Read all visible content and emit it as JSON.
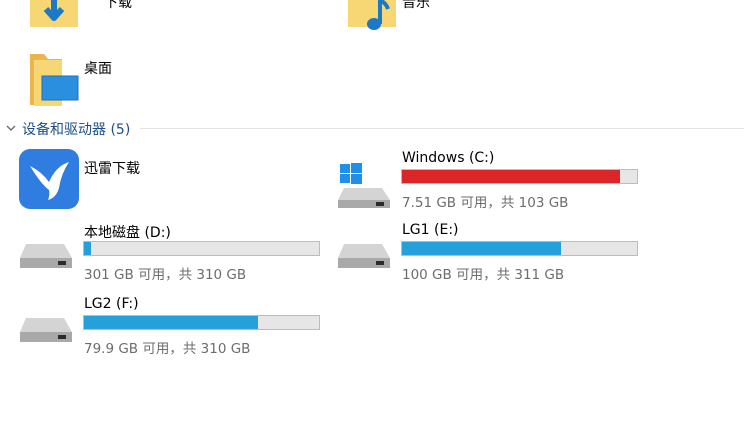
{
  "folders": [
    {
      "label": "下载",
      "icon": "downloads-folder-icon"
    },
    {
      "label": "音乐",
      "icon": "music-folder-icon"
    },
    {
      "label": "桌面",
      "icon": "desktop-folder-icon"
    }
  ],
  "section": {
    "title": "设备和驱动器 (5)",
    "chevron": "chevron-down-icon"
  },
  "app": {
    "label": "迅雷下载",
    "icon": "thunder-bird-icon",
    "accent": "#2f7de1"
  },
  "drives": [
    {
      "name": "Windows (C:)",
      "space": "7.51 GB 可用，共 103 GB",
      "used_fraction": 0.927,
      "bar_color": "#da2626",
      "icon": "windows-drive-icon"
    },
    {
      "name": "本地磁盘 (D:)",
      "space": "301 GB 可用，共 310 GB",
      "used_fraction": 0.029,
      "bar_color": "#26a0da",
      "icon": "hard-drive-icon"
    },
    {
      "name": "LG1 (E:)",
      "space": "100 GB 可用，共 311 GB",
      "used_fraction": 0.678,
      "bar_color": "#26a0da",
      "icon": "hard-drive-icon"
    },
    {
      "name": "LG2 (F:)",
      "space": "79.9 GB 可用，共 310 GB",
      "used_fraction": 0.742,
      "bar_color": "#26a0da",
      "icon": "hard-drive-icon"
    }
  ]
}
